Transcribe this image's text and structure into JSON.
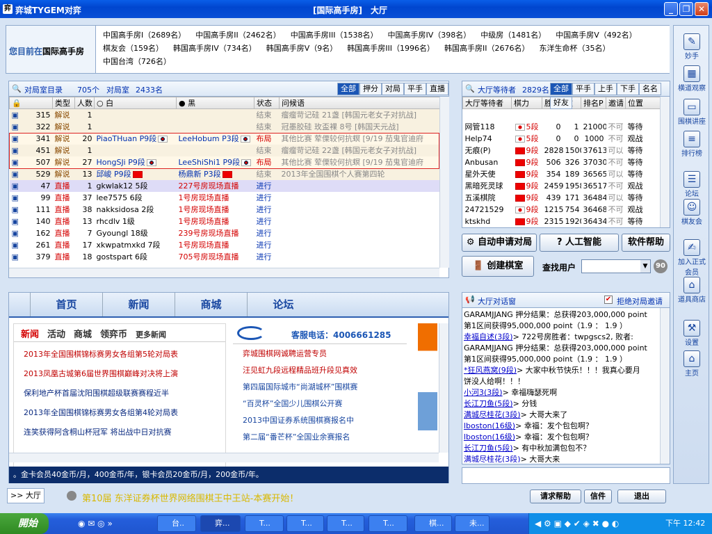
{
  "window": {
    "title": "弈城TYGEM对弈",
    "center_title": "[国际高手房]　大厅"
  },
  "location": {
    "prefix": "您目前在",
    "current": "国际高手房",
    "rooms": [
      "中国高手房I（2689名）",
      "中国高手房II（2462名）",
      "中国高手房III（1538名）",
      "中国高手房IV（398名）",
      "中级房（1481名）",
      "中国高手房V（492名）",
      "棋友会（159名）",
      "韩国高手房IV（734名）",
      "韩国高手房V（9名）",
      "韩国高手房III（1996名）",
      "韩国高手房II（2676名）",
      "东洋生命杯（35名）",
      "中国台湾（726名）"
    ]
  },
  "games": {
    "title": "对局室目录",
    "count1": "705个",
    "count2_label": "对局室",
    "count2": "2433名",
    "tabs": [
      "全部",
      "押分",
      "对局",
      "平手",
      "直播"
    ],
    "columns": [
      "",
      "类型",
      "人数",
      "白",
      "黑",
      "状态",
      "问候语"
    ],
    "rows": [
      {
        "no": "315",
        "type": "解说",
        "n": "1",
        "white": "",
        "black": "",
        "status": "结束",
        "msg": "瘤瘤苛记硅 21盏 [韩国元老女子对抗战]"
      },
      {
        "no": "322",
        "type": "解说",
        "n": "1",
        "white": "",
        "black": "",
        "status": "结束",
        "msg": "冠墨胶硅 玫盃裸 8号 [韩国天元战]"
      },
      {
        "no": "341",
        "type": "解说",
        "n": "20",
        "white": "PiaoTHuan P9段",
        "black": "LeeHobum P3段",
        "status": "布局",
        "msg": "其他比赛 荤傈较何抗螟 [9/19 茄鬼官迪府"
      },
      {
        "no": "451",
        "type": "解说",
        "n": "1",
        "white": "",
        "black": "",
        "status": "结束",
        "msg": "瘤瘤苛记硅 22盏 [韩国元老女子对抗战]"
      },
      {
        "no": "507",
        "type": "解说",
        "n": "27",
        "white": "HongSJi P9段",
        "black": "LeeShiShi1 P9段",
        "status": "布局",
        "msg": "其他比赛 荤傈较何抗螟 [9/19 茄鬼官迪府"
      },
      {
        "no": "529",
        "type": "解说",
        "n": "13",
        "white": "邱峻 P9段",
        "black": "杨鼎新 P3段",
        "status": "结束",
        "msg": "2013年全国围棋个人赛第四轮"
      },
      {
        "no": "47",
        "type": "直播",
        "n": "1",
        "white": "gkwlak12 5段",
        "black": "227号房现场直播",
        "status": "进行",
        "msg": ""
      },
      {
        "no": "99",
        "type": "直播",
        "n": "37",
        "white": "lee7575 6段",
        "black": "1号房现场直播",
        "status": "进行",
        "msg": ""
      },
      {
        "no": "111",
        "type": "直播",
        "n": "38",
        "white": "nakksidosa 2段",
        "black": "1号房现场直播",
        "status": "进行",
        "msg": ""
      },
      {
        "no": "140",
        "type": "直播",
        "n": "13",
        "white": "rhcdlv 1级",
        "black": "1号房现场直播",
        "status": "进行",
        "msg": ""
      },
      {
        "no": "162",
        "type": "直播",
        "n": "7",
        "white": "Gyoungl 18级",
        "black": "239号房现场直播",
        "status": "进行",
        "msg": ""
      },
      {
        "no": "261",
        "type": "直播",
        "n": "17",
        "white": "xkwpatmxkd 7段",
        "black": "1号房现场直播",
        "status": "进行",
        "msg": ""
      },
      {
        "no": "379",
        "type": "直播",
        "n": "18",
        "white": "gostspart 6段",
        "black": "705号房现场直播",
        "status": "进行",
        "msg": ""
      }
    ]
  },
  "waiting": {
    "title": "大厅等待者",
    "count": "2829名",
    "tabs": [
      "全部",
      "平手",
      "上手",
      "下手",
      "名名",
      "好友"
    ],
    "columns": [
      "大厅等待者",
      "棋力",
      "胜",
      "败",
      "排名P",
      "邀请",
      "位置"
    ],
    "rows": [
      {
        "name": "网管118",
        "rank": "5段",
        "w": "0",
        "l": "1",
        "pts": "21000",
        "inv": "不可",
        "pos": "等待"
      },
      {
        "name": "Help74",
        "rank": "5段",
        "w": "0",
        "l": "0",
        "pts": "1000",
        "inv": "不可",
        "pos": "观战"
      },
      {
        "name": "无痕(P)",
        "rank": "9段",
        "w": "2828",
        "l": "1500",
        "pts": "37613",
        "inv": "可以",
        "pos": "等待"
      },
      {
        "name": "Anbusan",
        "rank": "9段",
        "w": "506",
        "l": "326",
        "pts": "37030",
        "inv": "不可",
        "pos": "等待"
      },
      {
        "name": "星外天使",
        "rank": "9段",
        "w": "354",
        "l": "189",
        "pts": "36565",
        "inv": "可以",
        "pos": "等待"
      },
      {
        "name": "黑暗死灵球",
        "rank": "9段",
        "w": "2459",
        "l": "1958",
        "pts": "36517",
        "inv": "不可",
        "pos": "观战"
      },
      {
        "name": "五溪棋院",
        "rank": "9段",
        "w": "439",
        "l": "171",
        "pts": "36484",
        "inv": "可以",
        "pos": "等待"
      },
      {
        "name": "24721529",
        "rank": "9段",
        "w": "1215",
        "l": "754",
        "pts": "36468",
        "inv": "不可",
        "pos": "观战"
      },
      {
        "name": "ktskhd",
        "rank": "9段",
        "w": "2315",
        "l": "1920",
        "pts": "36434",
        "inv": "不可",
        "pos": "等待"
      }
    ]
  },
  "buttons": {
    "auto": "自动申请对局",
    "ai": "人工智能",
    "help": "软件帮助",
    "create": "创建棋室",
    "find": "查找用户",
    "go": "90"
  },
  "news": {
    "nav": [
      "首页",
      "新闻",
      "商城",
      "论坛"
    ],
    "tabs": [
      "新闻",
      "活动",
      "商城",
      "领弈币",
      "更多新闻"
    ],
    "left": [
      "2013年全国围棋锦标赛男女各组第5轮对局表",
      "2013凤凰古城第6届世界围棋巅峰对决将上演",
      "保利地产杯首届沈阳围棋超级联赛赛程近半",
      "2013年全国围棋锦标赛男女各组第4轮对局表",
      "连笑获得阿含桐山杯冠军 将出战中日对抗赛"
    ],
    "phone": "客服电话：4006661285",
    "right": [
      "弈城围棋网诚聘运营专员",
      "汪见虹九段远程精品班升段见真效",
      "第四届国际城市“尚湖城杯”围棋赛",
      "“百灵杯”全国少儿围棋公开赛",
      "2013中国证券系统围棋赛报名中",
      "第二届“番芒杯”全国业余赛报名"
    ],
    "ticker": "。金卡会员40金币/月，400金币/年，银卡会员20金币/月，200金币/年。"
  },
  "chat": {
    "title": "大厅对话窗",
    "refuse": "拒绝对局邀请",
    "lines": [
      {
        "u": "",
        "t": "GARAMJJANG 押分结果：总获得203,000,000 point"
      },
      {
        "u": "",
        "t": "第1区间获得95,000,000 point（1.9 ： 1.9 ）"
      },
      {
        "u": "幸福自述(3段)",
        "t": "> 722号房胜者：twpgscs2, 败者:"
      },
      {
        "u": "",
        "t": "GARAMJJANG 押分结果：总获得203,000,000 point"
      },
      {
        "u": "",
        "t": "第1区间获得95,000,000 point（1.9 ： 1.9 ）"
      },
      {
        "u": "*狂风燕窝(9段)",
        "t": "> 大家中秋节快乐！！！我真心要月"
      },
      {
        "u": "",
        "t": "饼没人给啊！！！"
      },
      {
        "u": "小河3(3段)",
        "t": "> 幸福嗨瑟死啊"
      },
      {
        "u": "长江刀鱼(5段)",
        "t": "> 分钱"
      },
      {
        "u": "满城尽桂花(3段)",
        "t": "> 大哥大来了"
      },
      {
        "u": "lboston(16级)",
        "t": "> 幸福：发个包包啊？"
      },
      {
        "u": "lboston(16级)",
        "t": "> 幸福：发个包包啊？"
      },
      {
        "u": "长江刀鱼(5段)",
        "t": "> 有中秋加满包包不？"
      },
      {
        "u": "满城尽桂花(3段)",
        "t": "> 大哥大来"
      }
    ]
  },
  "side": [
    "妙手",
    "横道观察",
    "围棋讲座",
    "排行榜",
    "论坛",
    "棋友会",
    "加入正式会员",
    "道具商店",
    "设置",
    "主页"
  ],
  "status": {
    "tab": ">> 大厅",
    "marquee": "第10届 东洋证券杯世界网络围棋王中王站-本赛开始！",
    "b1": "请求帮助",
    "b2": "信件",
    "b3": "退出"
  },
  "taskbar": {
    "start": "開始",
    "tasks": [
      "台..",
      "弈...",
      "T...",
      "T...",
      "T...",
      "T...",
      "棋...",
      "未..."
    ],
    "time": "下午 12:42"
  }
}
